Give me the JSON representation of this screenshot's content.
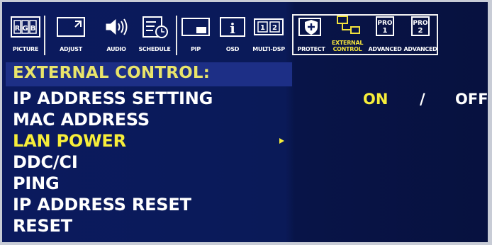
{
  "tabs": [
    {
      "label": "PICTURE",
      "icon": "rgb-icon",
      "glyph_text": [
        "R",
        "G",
        "B"
      ]
    },
    {
      "label": "ADJUST",
      "icon": "adjust-screen-icon"
    },
    {
      "label": "AUDIO",
      "icon": "speaker-icon"
    },
    {
      "label": "SCHEDULE",
      "icon": "schedule-list-clock-icon"
    },
    {
      "label": "PIP",
      "icon": "pip-icon"
    },
    {
      "label": "OSD",
      "icon": "info-icon",
      "glyph_text": "i"
    },
    {
      "label": "MULTI-DSP",
      "icon": "multi-display-icon",
      "glyph_text": [
        "1",
        "2"
      ]
    },
    {
      "label": "PROTECT",
      "icon": "shield-monitor-icon"
    },
    {
      "label": "EXTERNAL CONTROL",
      "label_lines": [
        "EXTERNAL",
        "CONTROL"
      ],
      "icon": "network-connection-icon",
      "active": true
    },
    {
      "label": "ADVANCED",
      "icon": "pro1-icon",
      "glyph_text": [
        "PRO",
        "1"
      ]
    },
    {
      "label": "ADVANCED",
      "icon": "pro2-icon",
      "glyph_text": [
        "PRO",
        "2"
      ]
    }
  ],
  "heading": "EXTERNAL CONTROL:",
  "menu_items": [
    {
      "label": "IP ADDRESS SETTING"
    },
    {
      "label": "MAC ADDRESS"
    },
    {
      "label": "LAN POWER",
      "selected": true
    },
    {
      "label": "DDC/CI"
    },
    {
      "label": "PING"
    },
    {
      "label": "IP ADDRESS RESET"
    },
    {
      "label": "RESET"
    }
  ],
  "options": {
    "on": "ON",
    "separator": "/",
    "off": "OFF",
    "selected": "ON"
  },
  "colors": {
    "background": "#0b1a5e",
    "highlight": "#f7ee3a",
    "text": "#ffffff",
    "heading": "#e9e46a"
  }
}
